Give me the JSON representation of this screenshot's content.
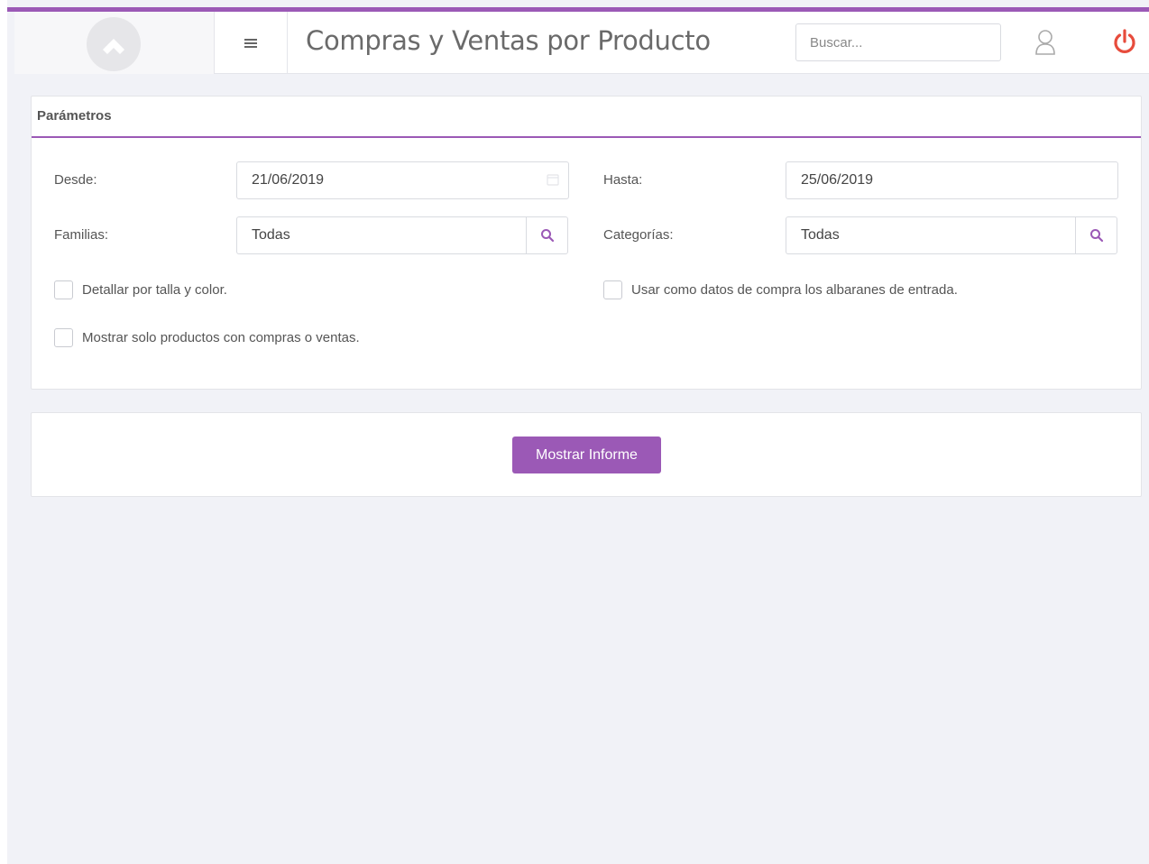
{
  "header": {
    "title": "Compras y Ventas por Producto",
    "search_placeholder": "Buscar...",
    "logo_icon": "logo-icon",
    "menu_icon": "hamburger-icon",
    "user_icon": "user-icon",
    "power_icon": "power-icon"
  },
  "params": {
    "heading": "Parámetros",
    "desde_label": "Desde:",
    "desde_value": "21/06/2019",
    "hasta_label": "Hasta:",
    "hasta_value": "25/06/2019",
    "familias_label": "Familias:",
    "familias_value": "Todas",
    "categorias_label": "Categorías:",
    "categorias_value": "Todas",
    "check_detallar": "Detallar por talla y color.",
    "check_albaranes": "Usar como datos de compra los albaranes de entrada.",
    "check_mostrar_solo": "Mostrar solo productos con compras o ventas."
  },
  "actions": {
    "show_report_label": "Mostrar Informe"
  },
  "colors": {
    "accent": "#9b59b6",
    "power": "#e74c3c",
    "background": "#f1f2f7"
  }
}
